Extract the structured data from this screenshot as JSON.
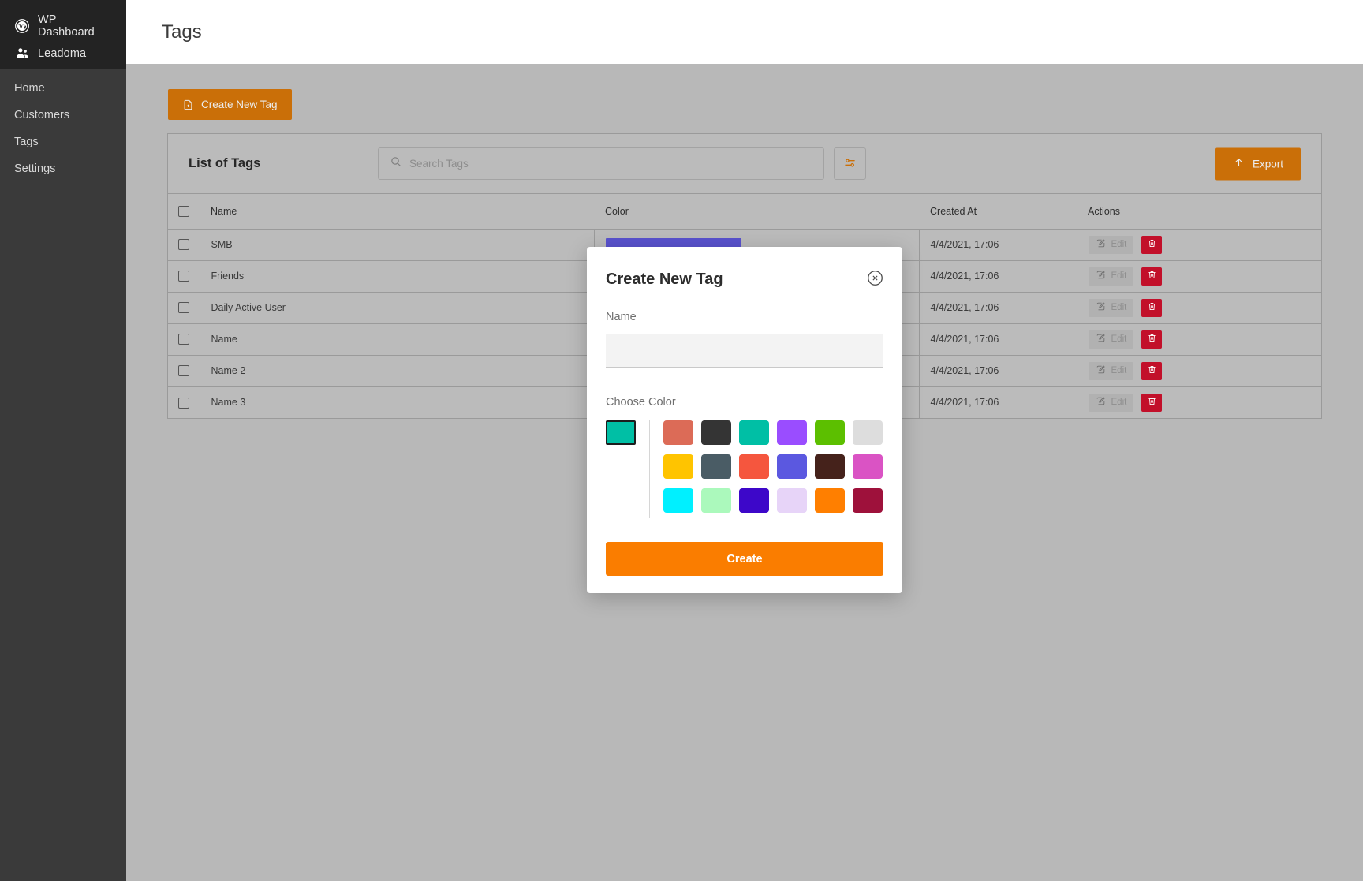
{
  "sidebar": {
    "brand": [
      {
        "label": "WP Dashboard",
        "icon": "wordpress-icon"
      },
      {
        "label": "Leadoma",
        "icon": "users-icon"
      }
    ],
    "items": [
      {
        "label": "Home"
      },
      {
        "label": "Customers"
      },
      {
        "label": "Tags"
      },
      {
        "label": "Settings"
      }
    ]
  },
  "header": {
    "title": "Tags"
  },
  "toolbar": {
    "create_new_tag_label": "Create New Tag"
  },
  "panel": {
    "title": "List of Tags",
    "search_placeholder": "Search Tags",
    "search_value": "",
    "filter_icon": "sliders-icon",
    "export_label": "Export",
    "export_icon": "upload-arrow-icon"
  },
  "table": {
    "columns": [
      "Name",
      "Color",
      "Created At",
      "Actions"
    ],
    "edit_label": "Edit",
    "rows": [
      {
        "name": "SMB",
        "color": "#5952cd",
        "created_at": "4/4/2021, 17:06"
      },
      {
        "name": "Friends",
        "color": "#5952cd",
        "created_at": "4/4/2021, 17:06"
      },
      {
        "name": "Daily Active User",
        "color": "#5952cd",
        "created_at": "4/4/2021, 17:06"
      },
      {
        "name": "Name",
        "color": "#5952cd",
        "created_at": "4/4/2021, 17:06"
      },
      {
        "name": "Name 2",
        "color": "#5952cd",
        "created_at": "4/4/2021, 17:06"
      },
      {
        "name": "Name 3",
        "color": "#5952cd",
        "created_at": "4/4/2021, 17:06"
      }
    ]
  },
  "modal": {
    "title": "Create New Tag",
    "close_icon": "close-circle-icon",
    "name_label": "Name",
    "name_value": "",
    "name_placeholder": "",
    "choose_color_label": "Choose Color",
    "selected_color": "#00bfa5",
    "palette": [
      [
        "#dc6b57",
        "#343434",
        "#00bfa5",
        "#9a4dff",
        "#5cbf00",
        "#dddddd"
      ],
      [
        "#ffc400",
        "#4a5c65",
        "#f5563e",
        "#5b58e0",
        "#45221b",
        "#da53c4"
      ],
      [
        "#00f0ff",
        "#abf9bc",
        "#3d07c9",
        "#e7d4f8",
        "#ff7f00",
        "#9e113b"
      ]
    ],
    "create_label": "Create"
  },
  "colors": {
    "accent_orange": "#ca6f08",
    "create_orange": "#fa7d00",
    "danger_red": "#c2102a",
    "sidebar_dark": "#3a3a3a",
    "sidebar_brand_dark": "#232323",
    "page_bg": "#b8b8b8"
  }
}
